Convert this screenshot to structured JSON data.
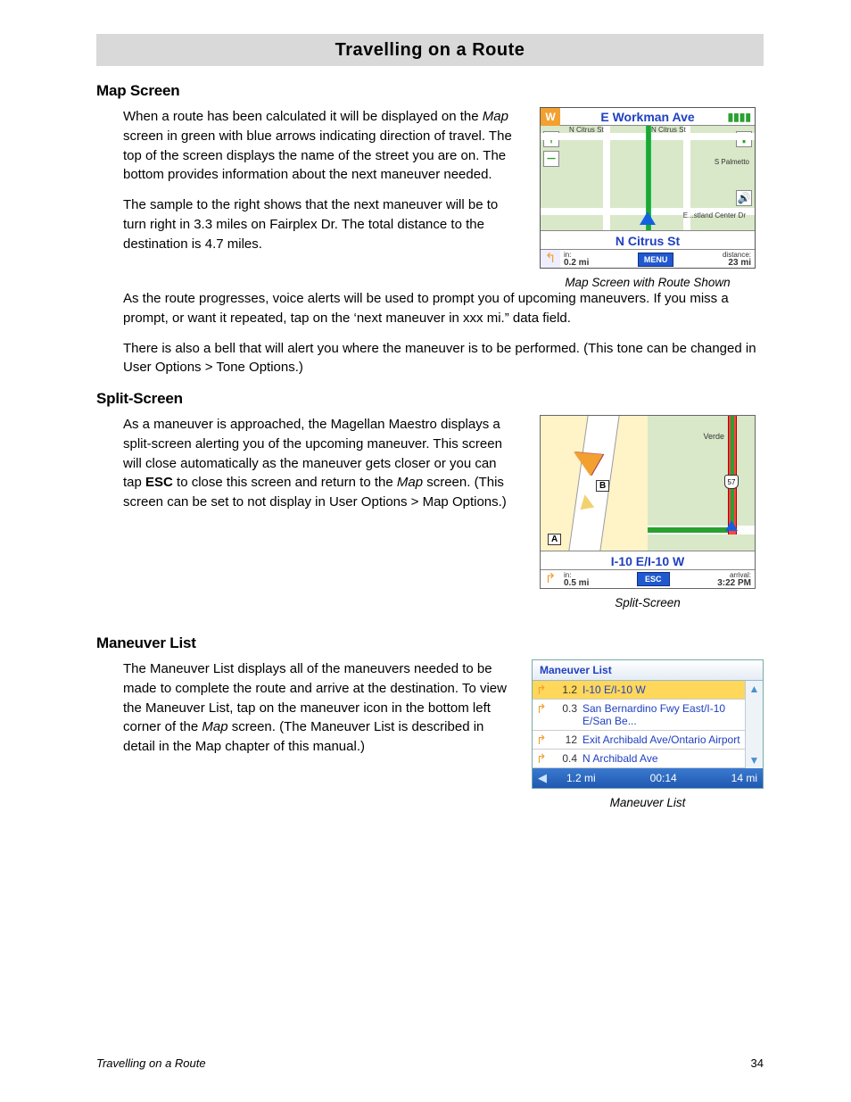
{
  "page": {
    "title": "Travelling on a Route",
    "footer_title": "Travelling on a Route",
    "number": "34"
  },
  "sections": {
    "map": {
      "heading": "Map Screen",
      "p1a": "When a route has been calculated it will be displayed on the ",
      "p1_ital": "Map",
      "p1b": " screen in green with blue arrows indicating direction of travel.  The top of the screen displays the name of the street you are on.  The bottom provides information about the next maneuver needed.",
      "p2": "The sample to the right shows that the next maneuver will be to turn right in 3.3 miles on Fairplex Dr.  The total distance to the destination is 4.7 miles.",
      "p3": "As the route progresses, voice alerts will be used to prompt you of upcoming maneuvers.  If you miss a prompt, or want it repeated, tap on the ‘next maneuver in xxx mi.” data field.",
      "p4": "There is also a bell that will alert you where the maneuver is to be performed. (This tone can be changed in User Options >  Tone Options.)"
    },
    "split": {
      "heading": "Split-Screen",
      "p1a": "As a maneuver is approached, the Magellan Maestro displays a split-screen alerting you of the upcoming maneuver. This screen will close automatically as the maneuver gets closer or you can tap ",
      "p1_bold": "ESC",
      "p1b": " to close this screen and return to the ",
      "p1_ital": "Map",
      "p1c": " screen. (This screen can be set to not display in User Options > Map Options.)"
    },
    "mlist": {
      "heading": "Maneuver List",
      "p1a": "The Maneuver List displays all of the maneuvers needed to be made to complete the route and arrive at the destination.  To view the Maneuver List, tap on the maneuver icon in the bottom left corner of the ",
      "p1_ital": "Map",
      "p1b": " screen.   (The Maneuver List is described in detail in the Map chapter of this manual.)"
    }
  },
  "fig1": {
    "caption": "Map Screen with Route Shown",
    "dir": "W",
    "top_street": "E Workman Ave",
    "labels": {
      "citrus_l": "N Citrus St",
      "citrus_r": "N Citrus St",
      "palmetto": "S Palmetto",
      "eastland": "E...stland Center Dr"
    },
    "next_street": "N Citrus St",
    "bottom": {
      "in_label": "in:",
      "in_val": "0.2 mi",
      "menu": "MENU",
      "dist_label": "distance:",
      "dist_val": "23 mi"
    }
  },
  "fig2": {
    "caption": "Split-Screen",
    "labelA": "A",
    "labelB": "B",
    "verde": "Verde",
    "shield": "57",
    "next_street": "I-10 E/I-10 W",
    "bottom": {
      "in_label": "in:",
      "in_val": "0.5 mi",
      "esc": "ESC",
      "arr_label": "arrival:",
      "arr_val": "3:22 PM"
    }
  },
  "fig3": {
    "caption": "Maneuver List",
    "title": "Maneuver List",
    "rows": [
      {
        "dist": "1.2",
        "text": "I-10 E/I-10 W",
        "sel": true
      },
      {
        "dist": "0.3",
        "text": "San Bernardino Fwy East/I-10 E/San Be..."
      },
      {
        "dist": "12",
        "text": "Exit Archibald Ave/Ontario Airport"
      },
      {
        "dist": "0.4",
        "text": "N Archibald Ave"
      }
    ],
    "footer": {
      "d1": "1.2 mi",
      "t": "00:14",
      "d2": "14 mi"
    }
  }
}
